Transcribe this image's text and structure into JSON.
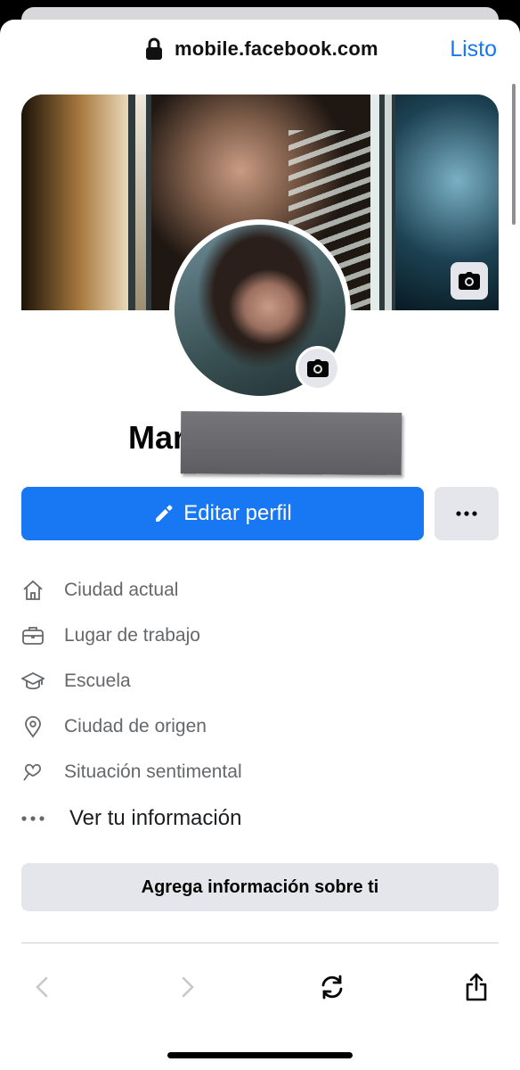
{
  "browser": {
    "url": "mobile.facebook.com",
    "done_label": "Listo"
  },
  "profile": {
    "name_visible": "Mar",
    "edit_label": "Editar perfil"
  },
  "info_items": [
    {
      "label": "Ciudad actual",
      "icon": "home-icon"
    },
    {
      "label": "Lugar de trabajo",
      "icon": "briefcase-icon"
    },
    {
      "label": "Escuela",
      "icon": "graduation-cap-icon"
    },
    {
      "label": "Ciudad de origen",
      "icon": "location-pin-icon"
    },
    {
      "label": "Situación sentimental",
      "icon": "heart-icon"
    }
  ],
  "see_info_label": "Ver tu información",
  "add_info_label": "Agrega información sobre ti",
  "colors": {
    "accent": "#1877f2",
    "secondary_button": "#e4e6eb",
    "muted_text": "#65676b"
  }
}
